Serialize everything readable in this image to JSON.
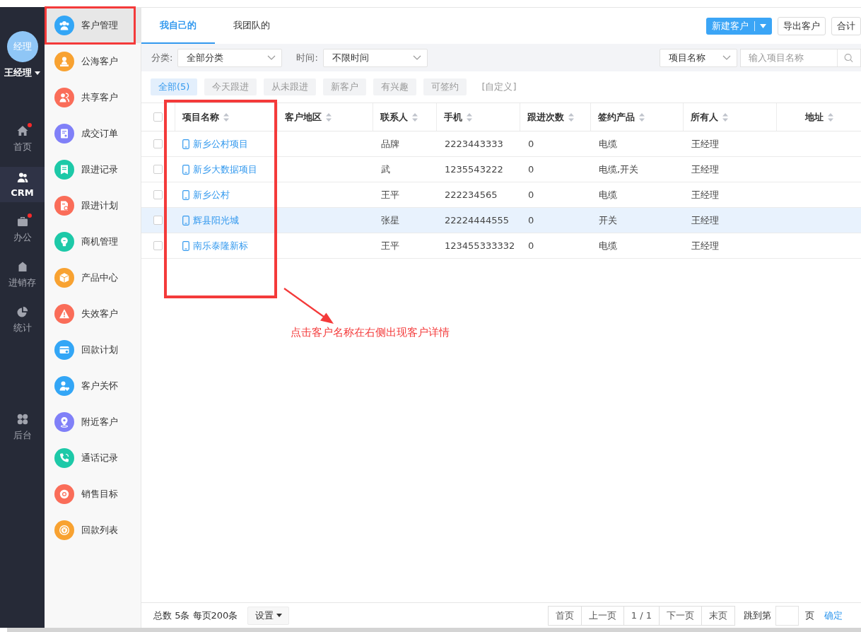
{
  "rail": {
    "avatar": "经理",
    "user": "王经理",
    "items": [
      {
        "kind": "home",
        "label": "首页",
        "selected": false,
        "dot": true
      },
      {
        "kind": "crm",
        "label": "CRM",
        "selected": true,
        "dot": false
      },
      {
        "kind": "office",
        "label": "办公",
        "selected": false,
        "dot": true
      },
      {
        "kind": "stock",
        "label": "进销存",
        "selected": false,
        "dot": false
      },
      {
        "kind": "stats",
        "label": "统计",
        "selected": false,
        "dot": false
      },
      {
        "kind": "admin",
        "label": "后台",
        "selected": false,
        "dot": false
      }
    ]
  },
  "menu": {
    "items": [
      {
        "kind": "team",
        "label": "客户管理",
        "selected": true,
        "color": "#33a6f6"
      },
      {
        "kind": "person",
        "label": "公海客户",
        "selected": false,
        "color": "#f8a231"
      },
      {
        "kind": "share",
        "label": "共享客户",
        "selected": false,
        "color": "#fa6d59"
      },
      {
        "kind": "document",
        "label": "成交订单",
        "selected": false,
        "color": "#8080f8"
      },
      {
        "kind": "note",
        "label": "跟进记录",
        "selected": false,
        "color": "#1dc9a8"
      },
      {
        "kind": "schedule",
        "label": "跟进计划",
        "selected": false,
        "color": "#fa6d59"
      },
      {
        "kind": "bulb",
        "label": "商机管理",
        "selected": false,
        "color": "#1dc9a8"
      },
      {
        "kind": "cube",
        "label": "产品中心",
        "selected": false,
        "color": "#f8a231"
      },
      {
        "kind": "warning",
        "label": "失效客户",
        "selected": false,
        "color": "#fa6d59"
      },
      {
        "kind": "card",
        "label": "回款计划",
        "selected": false,
        "color": "#33a6f6"
      },
      {
        "kind": "care",
        "label": "客户关怀",
        "selected": false,
        "color": "#33a6f6"
      },
      {
        "kind": "pin",
        "label": "附近客户",
        "selected": false,
        "color": "#8080f8"
      },
      {
        "kind": "phone",
        "label": "通话记录",
        "selected": false,
        "color": "#1dc9a8"
      },
      {
        "kind": "target",
        "label": "销售目标",
        "selected": false,
        "color": "#fa6d59"
      },
      {
        "kind": "coin",
        "label": "回款列表",
        "selected": false,
        "color": "#f8a231"
      }
    ]
  },
  "tabs": [
    {
      "label": "我自己的",
      "selected": true
    },
    {
      "label": "我团队的",
      "selected": false
    }
  ],
  "actions": [
    {
      "kind": "split",
      "label": "新建客户"
    },
    {
      "kind": "plain",
      "label": "导出客户"
    },
    {
      "kind": "plain",
      "label": "合计"
    }
  ],
  "filters": [
    {
      "label": "分类:",
      "value": "全部分类"
    },
    {
      "label": "时间:",
      "value": "不限时间"
    }
  ],
  "search": {
    "field": "项目名称",
    "placeholder": "输入项目名称"
  },
  "quick_filters": [
    {
      "kind": "chip",
      "label": "全部(5)",
      "selected": true
    },
    {
      "kind": "chip",
      "label": "今天跟进",
      "selected": false
    },
    {
      "kind": "chip",
      "label": "从未跟进",
      "selected": false
    },
    {
      "kind": "chip",
      "label": "新客户",
      "selected": false
    },
    {
      "kind": "chip",
      "label": "有兴趣",
      "selected": false
    },
    {
      "kind": "chip",
      "label": "可签约",
      "selected": false
    },
    {
      "kind": "link",
      "label": "[自定义]",
      "selected": false
    }
  ],
  "table": {
    "select_all": {
      "checked": false
    },
    "columns": [
      "项目名称",
      "客户地区",
      "联系人",
      "手机",
      "跟进次数",
      "签约产品",
      "所有人",
      "地址"
    ],
    "rows": [
      {
        "selected": false,
        "checked": false,
        "name": "新乡公村项目",
        "contact": "品牌",
        "phone": "2223443333",
        "follow_ups": "0",
        "product": "电缆",
        "owner": "王经理"
      },
      {
        "selected": false,
        "checked": false,
        "name": "新乡大数据项目",
        "contact": "武",
        "phone": "1235543222",
        "follow_ups": "0",
        "product": "电缆,开关",
        "owner": "王经理"
      },
      {
        "selected": false,
        "checked": false,
        "name": "新乡公村",
        "contact": "王平",
        "phone": "222234565",
        "follow_ups": "0",
        "product": "电缆",
        "owner": "王经理"
      },
      {
        "selected": true,
        "checked": false,
        "name": "辉县阳光城",
        "contact": "张星",
        "phone": "22224444555",
        "follow_ups": "0",
        "product": "开关",
        "owner": "王经理"
      },
      {
        "selected": false,
        "checked": false,
        "name": "南乐泰隆新标",
        "contact": "王平",
        "phone": "123455333332",
        "follow_ups": "0",
        "product": "电缆",
        "owner": "王经理"
      }
    ]
  },
  "annotation": {
    "text": "点击客户名称在右侧出现客户详情"
  },
  "pager": {
    "summary": "总数 5条 每页200条",
    "settings": "设置",
    "pages": [
      "首页",
      "上一页",
      "1 / 1",
      "下一页",
      "末页"
    ],
    "jump_label": "跳到第",
    "unit": "页",
    "confirm": "确定"
  }
}
